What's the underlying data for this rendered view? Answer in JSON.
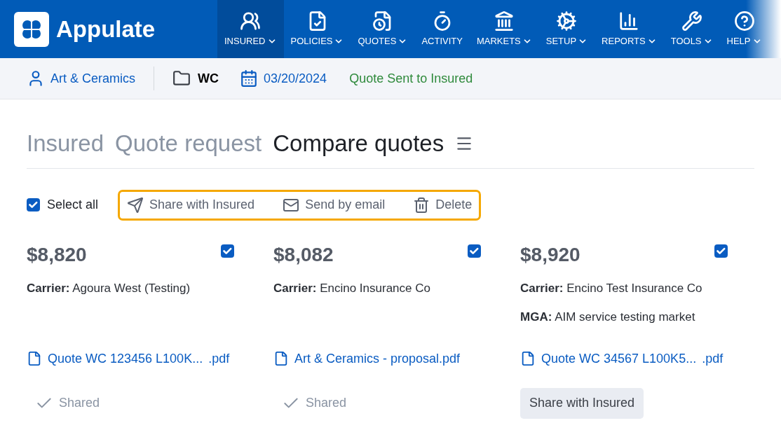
{
  "brand": "Appulate",
  "nav": [
    {
      "label": "INSURED",
      "selected": true,
      "menu": true,
      "kind": "users"
    },
    {
      "label": "POLICIES",
      "selected": false,
      "menu": true,
      "kind": "policy"
    },
    {
      "label": "QUOTES",
      "selected": false,
      "menu": true,
      "kind": "quote"
    },
    {
      "label": "ACTIVITY",
      "selected": false,
      "menu": false,
      "kind": "activity"
    },
    {
      "label": "MARKETS",
      "selected": false,
      "menu": true,
      "kind": "markets"
    },
    {
      "label": "SETUP",
      "selected": false,
      "menu": true,
      "kind": "setup"
    },
    {
      "label": "REPORTS",
      "selected": false,
      "menu": true,
      "kind": "reports"
    },
    {
      "label": "TOOLS",
      "selected": false,
      "menu": true,
      "kind": "tools"
    },
    {
      "label": "HELP",
      "selected": false,
      "menu": true,
      "kind": "help"
    }
  ],
  "context": {
    "insured": "Art & Ceramics",
    "line": "WC",
    "date": "03/20/2024",
    "status": "Quote Sent to Insured"
  },
  "steps": [
    {
      "label": "Insured",
      "selected": false
    },
    {
      "label": "Quote request",
      "selected": false
    },
    {
      "label": "Compare quotes",
      "selected": true
    }
  ],
  "toolbar": {
    "select_all": {
      "label": "Select all",
      "checked": true
    },
    "actions": [
      {
        "label": "Share with Insured",
        "kind": "share"
      },
      {
        "label": "Send by email",
        "kind": "email"
      },
      {
        "label": "Delete",
        "kind": "delete"
      }
    ]
  },
  "quotes": [
    {
      "price": "$8,820",
      "checked": true,
      "fields": [
        {
          "label": "Carrier:",
          "value": "Agoura West (Testing)"
        }
      ],
      "file": {
        "name": "Quote WC 123456 L100K...",
        "ext": ".pdf"
      },
      "status": {
        "kind": "shared",
        "label": "Shared"
      }
    },
    {
      "price": "$8,082",
      "checked": true,
      "fields": [
        {
          "label": "Carrier:",
          "value": "Encino Insurance Co"
        }
      ],
      "file": {
        "name": "Art & Ceramics - proposal.pdf"
      },
      "status": {
        "kind": "shared",
        "label": "Shared"
      }
    },
    {
      "price": "$8,920",
      "checked": true,
      "fields": [
        {
          "label": "Carrier:",
          "value": "Encino Test Insurance Co"
        },
        {
          "label": "MGA:",
          "value": "AIM service testing market"
        }
      ],
      "file": {
        "name": "Quote WC 34567 L100K5...",
        "ext": ".pdf"
      },
      "status": {
        "kind": "button",
        "label": "Share with Insured"
      }
    }
  ]
}
